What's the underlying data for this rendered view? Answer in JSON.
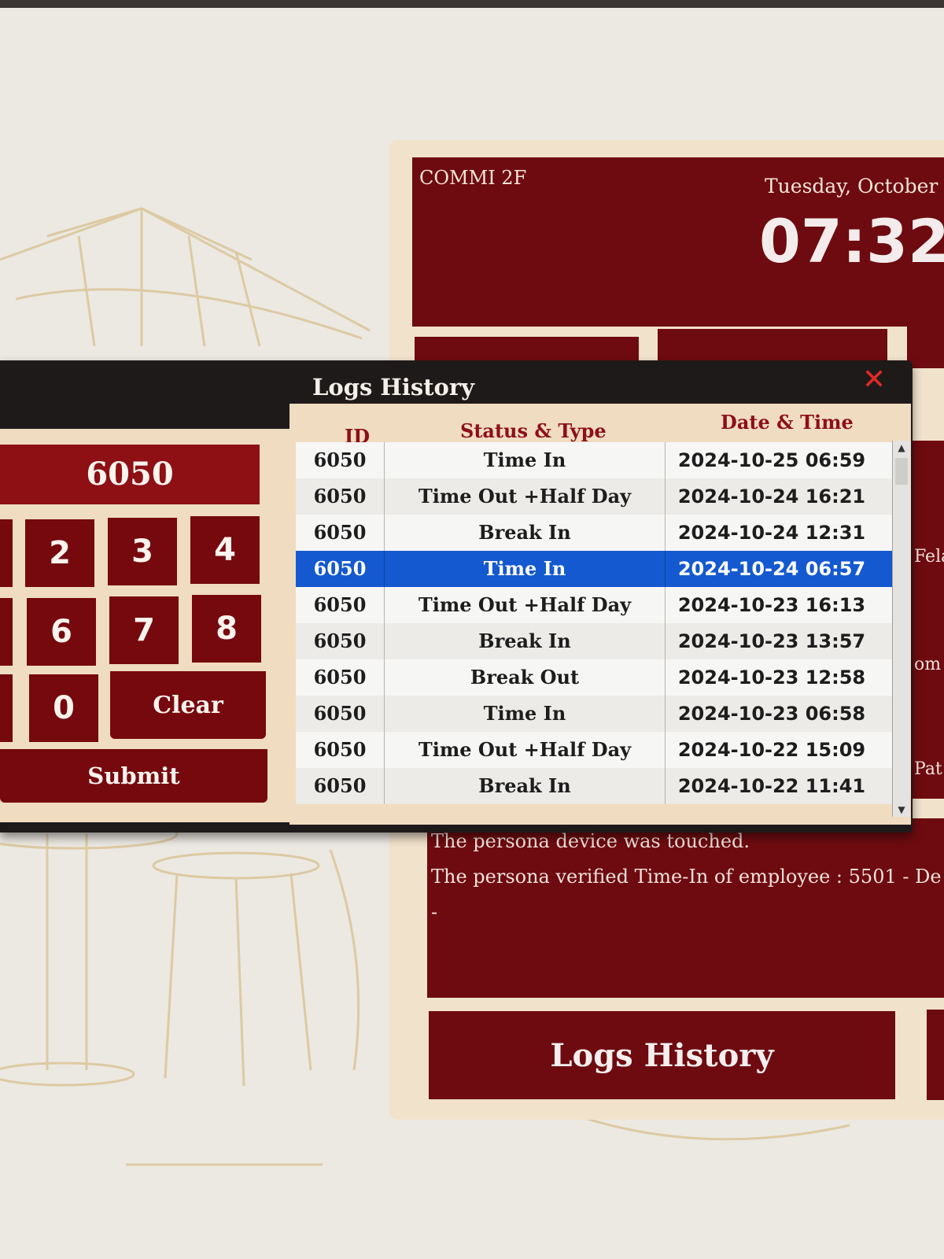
{
  "kiosk": {
    "location": "COMMI 2F",
    "date": "Tuesday, October",
    "time": "07:32",
    "side_labels": [
      "Fela",
      "om",
      "Pat"
    ]
  },
  "messages": [
    "The persona device was touched.",
    "The persona verified Time-In of employee : 5501 - De",
    "-"
  ],
  "logs_button_label": "Logs History",
  "dialog": {
    "title": "Logs History",
    "close_icon": "close-icon",
    "pin_value": "6050",
    "keys": {
      "k2": "2",
      "k3": "3",
      "k4": "4",
      "k6": "6",
      "k7": "7",
      "k8": "8",
      "k0": "0",
      "clear": "Clear",
      "submit": "Submit"
    },
    "columns": [
      "ID",
      "Status & Type",
      "Date & Time"
    ],
    "rows": [
      {
        "id": "6050",
        "status": "Time In",
        "datetime": "2024-10-25 06:59"
      },
      {
        "id": "6050",
        "status": "Time Out +Half Day",
        "datetime": "2024-10-24 16:21"
      },
      {
        "id": "6050",
        "status": "Break In",
        "datetime": "2024-10-24 12:31"
      },
      {
        "id": "6050",
        "status": "Time In",
        "datetime": "2024-10-24 06:57"
      },
      {
        "id": "6050",
        "status": "Time Out +Half Day",
        "datetime": "2024-10-23 16:13"
      },
      {
        "id": "6050",
        "status": "Break In",
        "datetime": "2024-10-23 13:57"
      },
      {
        "id": "6050",
        "status": "Break Out",
        "datetime": "2024-10-23 12:58"
      },
      {
        "id": "6050",
        "status": "Time In",
        "datetime": "2024-10-23 06:58"
      },
      {
        "id": "6050",
        "status": "Time Out +Half Day",
        "datetime": "2024-10-22 15:09"
      },
      {
        "id": "6050",
        "status": "Break In",
        "datetime": "2024-10-22 11:41"
      }
    ],
    "selected_row": 4
  },
  "colors": {
    "maroon": "#6e0b10",
    "pin_red": "#8e0f14",
    "header_text": "#8e1016",
    "selection_blue": "#1459cf",
    "close_red": "#e22a25",
    "panel_beige": "#f0dcc0"
  }
}
